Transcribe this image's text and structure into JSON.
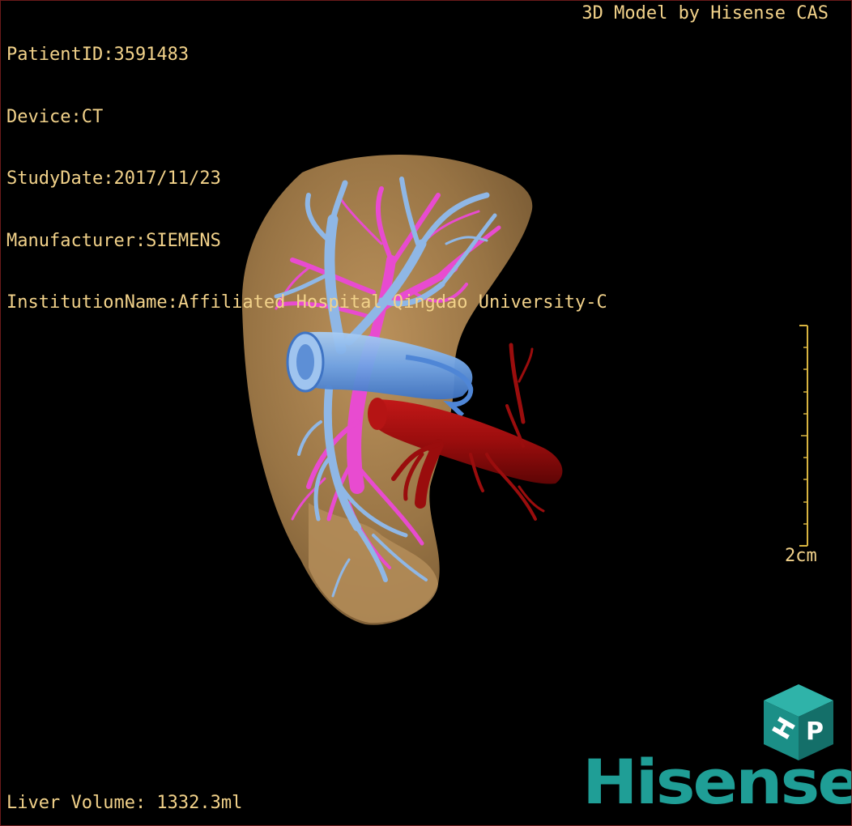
{
  "overlay": {
    "patient_id": "PatientID:3591483",
    "device": "Device:CT",
    "study_date": "StudyDate:2017/11/23",
    "manufacturer": "Manufacturer:SIEMENS",
    "institution": "InstitutionName:Affiliated Hospital Qingdao University-C",
    "model_credit": "3D Model by Hisense CAS",
    "liver_volume": "Liver Volume: 1332.3ml"
  },
  "scale_bar": {
    "label": "2cm"
  },
  "logo": {
    "text": "Hisense",
    "cube_letters": "HP",
    "color": "#1f9e96"
  },
  "colors": {
    "text": "#f2d28a",
    "liver": "#a4804f",
    "hepatic_vein": "#8fb7e6",
    "portal_vein": "#e84bd0",
    "ivc": "#6a9fe3",
    "artery": "#a01010"
  }
}
